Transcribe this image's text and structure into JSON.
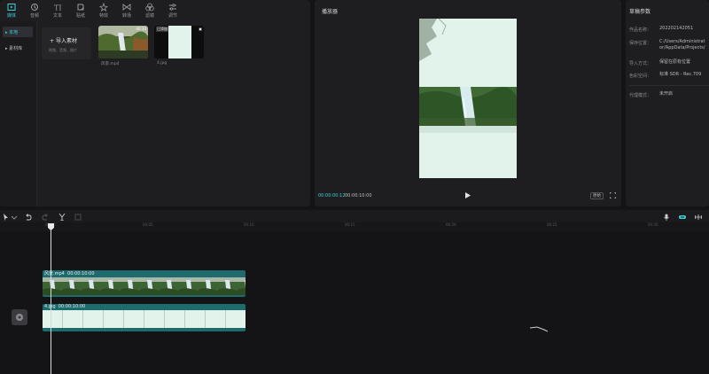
{
  "toolbar": {
    "tools": [
      {
        "label": "媒体",
        "icon": "media-icon",
        "active": true
      },
      {
        "label": "音频",
        "icon": "audio-icon",
        "active": false
      },
      {
        "label": "文本",
        "icon": "text-icon",
        "active": false
      },
      {
        "label": "贴纸",
        "icon": "sticker-icon",
        "active": false
      },
      {
        "label": "特效",
        "icon": "effects-icon",
        "active": false
      },
      {
        "label": "转场",
        "icon": "transition-icon",
        "active": false
      },
      {
        "label": "滤镜",
        "icon": "filter-icon",
        "active": false
      },
      {
        "label": "调节",
        "icon": "adjust-icon",
        "active": false
      }
    ]
  },
  "sidebar": {
    "items": [
      {
        "label": "▸ 本地",
        "active": true
      },
      {
        "label": "▸ 素材库",
        "active": false
      }
    ]
  },
  "media": {
    "import_label": "导入素材",
    "import_hint": "视频、音频、图片",
    "clips": [
      {
        "name": "风景.mp4",
        "duration": "00:10"
      },
      {
        "name": "4.jpg",
        "badge": "已添加"
      }
    ]
  },
  "player": {
    "title": "播放器",
    "current_time": "00:00:00:12",
    "total_time": "00:00:10:00",
    "ratio_label": "原始"
  },
  "props": {
    "title": "草稿参数",
    "rows": [
      {
        "label": "作品名称：",
        "value": "202202142051"
      },
      {
        "label": "保存位置：",
        "value": "C:/Users/Administrator/AppData/Projects/com"
      },
      {
        "label": "导入方式：",
        "value": "保留在原有位置"
      },
      {
        "label": "色彩空间：",
        "value": "标准 SDR - Rec.709"
      },
      {
        "label": "代理模式：",
        "value": "未开启"
      }
    ]
  },
  "timeline": {
    "ticks": [
      "00:00",
      "00:05",
      "00:10",
      "00:15",
      "00:20",
      "00:25",
      "00:30"
    ],
    "tracks": [
      {
        "label": "风景.mp4",
        "duration": "00:00:10:00"
      },
      {
        "label": "4.jpg",
        "duration": "00:00:10:00"
      }
    ]
  },
  "colors": {
    "accent": "#3bd0d8",
    "track_bg": "#1e6b6e",
    "frame_light": "#e1f3ea"
  }
}
